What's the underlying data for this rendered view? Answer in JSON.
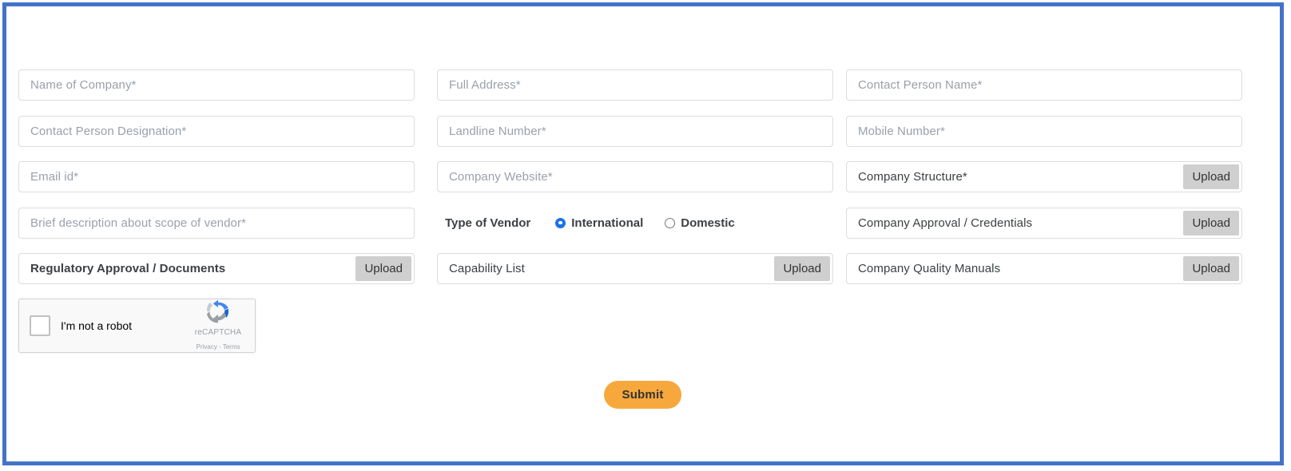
{
  "theme": {
    "frame_border_color": "#4273c8",
    "placeholder_color": "#9aa0ac",
    "label_color": "#3c4043",
    "upload_button_color": "#cfcfcf",
    "radio_accent_color": "#1a73e8",
    "submit_color": "#f7a83c"
  },
  "form": {
    "fields": {
      "name_of_company": {
        "placeholder": "Name of Company*"
      },
      "full_address": {
        "placeholder": "Full Address*"
      },
      "contact_person_name": {
        "placeholder": "Contact Person Name*"
      },
      "contact_person_designation": {
        "placeholder": "Contact Person Designation*"
      },
      "landline_number": {
        "placeholder": "Landline Number*"
      },
      "mobile_number": {
        "placeholder": "Mobile Number*"
      },
      "email_id": {
        "placeholder": "Email id*"
      },
      "company_website": {
        "placeholder": "Company Website*"
      },
      "company_structure": {
        "label": "Company Structure*",
        "upload_label": "Upload"
      },
      "brief_description": {
        "placeholder": "Brief description about scope of vendor*"
      },
      "company_approval": {
        "label": "Company Approval / Credentials",
        "upload_label": "Upload"
      },
      "regulatory_approval": {
        "label": "Regulatory Approval / Documents",
        "upload_label": "Upload"
      },
      "capability_list": {
        "label": "Capability List",
        "upload_label": "Upload"
      },
      "company_quality_manuals": {
        "label": "Company Quality Manuals",
        "upload_label": "Upload"
      }
    },
    "type_of_vendor": {
      "label": "Type of Vendor",
      "options": [
        {
          "label": "International",
          "selected": true
        },
        {
          "label": "Domestic",
          "selected": false
        }
      ]
    },
    "recaptcha": {
      "checkbox_label": "I'm not a robot",
      "brand_name": "reCAPTCHA",
      "legal_text": "Privacy - Terms"
    },
    "submit": {
      "label": "Submit"
    }
  }
}
